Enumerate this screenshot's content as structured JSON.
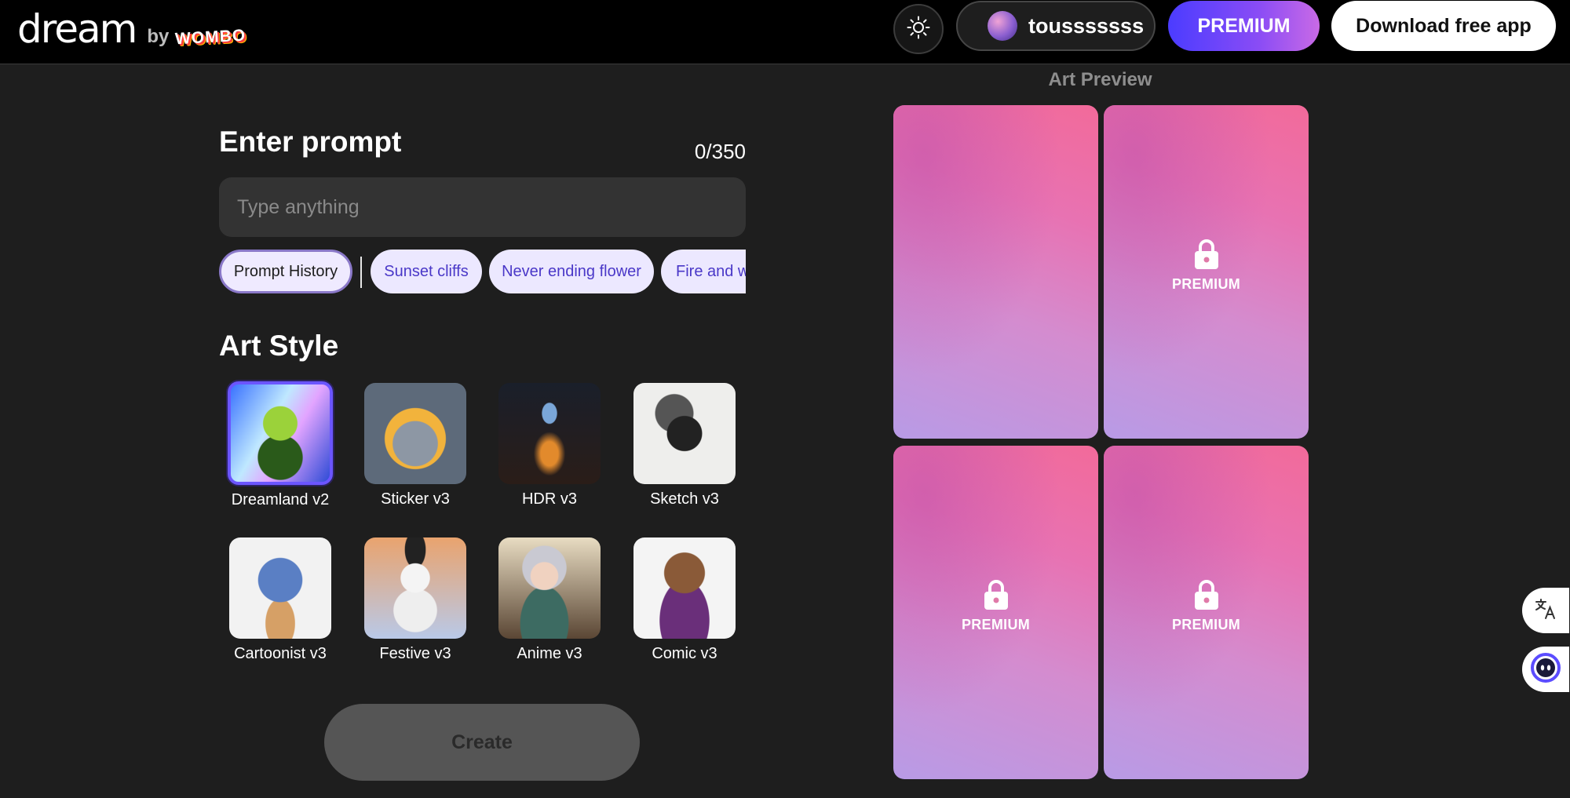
{
  "header": {
    "logo_text": "dream",
    "logo_by": "by",
    "logo_brand": "WOMBO",
    "theme_icon": "sun-icon",
    "username": "tousssssss",
    "premium_label": "PREMIUM",
    "download_label": "Download free app"
  },
  "prompt": {
    "title": "Enter prompt",
    "char_count": "0/350",
    "placeholder": "Type anything",
    "value": "",
    "history_label": "Prompt History",
    "suggestions": [
      "Sunset cliffs",
      "Never ending flower",
      "Fire and water"
    ]
  },
  "art_style": {
    "title": "Art Style",
    "selected": "Dreamland v2",
    "styles": [
      {
        "label": "Dreamland v2"
      },
      {
        "label": "Sticker v3"
      },
      {
        "label": "HDR v3"
      },
      {
        "label": "Sketch v3"
      },
      {
        "label": "Cartoonist v3"
      },
      {
        "label": "Festive v3"
      },
      {
        "label": "Anime v3"
      },
      {
        "label": "Comic v3"
      }
    ]
  },
  "create_label": "Create",
  "preview": {
    "title": "Art Preview",
    "cards": [
      {
        "locked": false,
        "label": ""
      },
      {
        "locked": true,
        "label": "PREMIUM"
      },
      {
        "locked": true,
        "label": "PREMIUM"
      },
      {
        "locked": true,
        "label": "PREMIUM"
      }
    ]
  },
  "floating": {
    "translate_icon": "translate-icon",
    "assistant_icon": "assistant-face-icon"
  },
  "colors": {
    "background": "#1e1e1e",
    "header": "#000000",
    "accent": "#6b55ff",
    "premium_gradient_start": "#4b3cff",
    "premium_gradient_end": "#c96ae6",
    "chip_text": "#4a38c8"
  }
}
